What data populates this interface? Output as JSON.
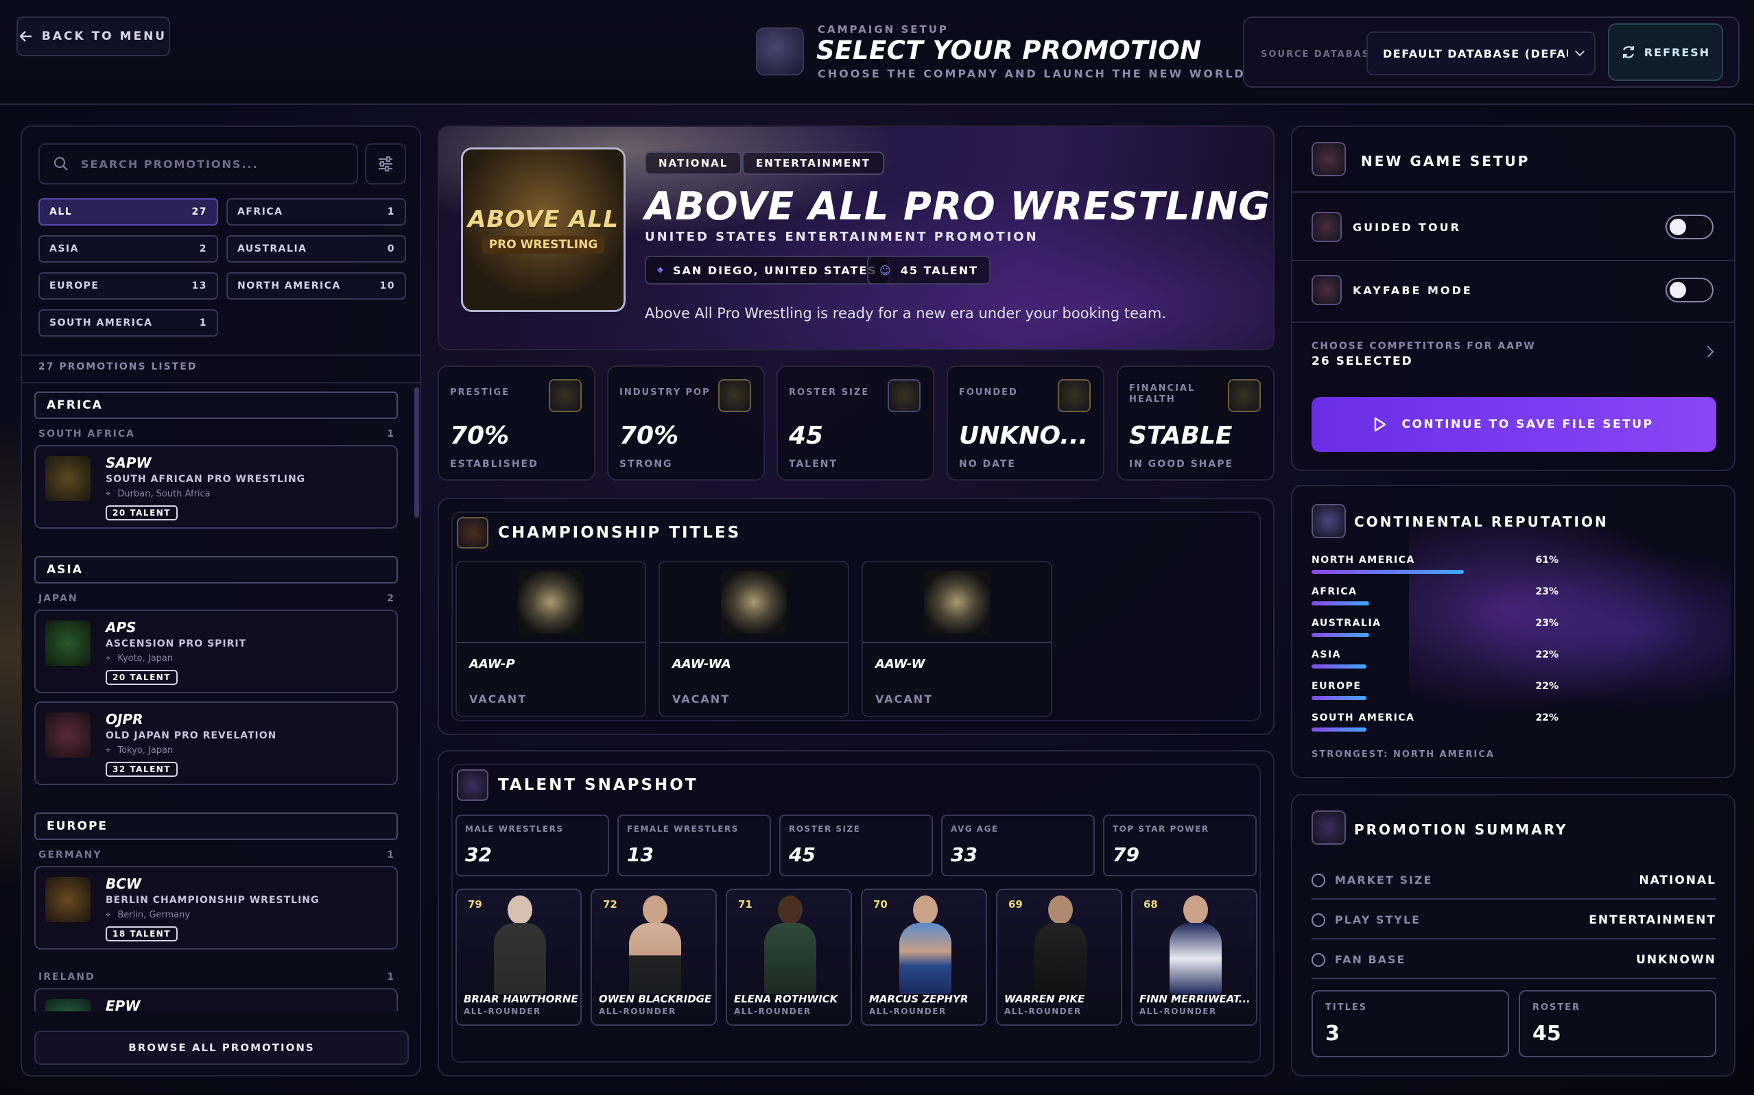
{
  "header": {
    "back_label": "BACK TO MENU",
    "kicker": "CAMPAIGN SETUP",
    "title": "SELECT YOUR PROMOTION",
    "subtitle": "CHOOSE THE COMPANY AND LAUNCH THE NEW WORLD STATE.",
    "source_label": "SOURCE DATABASE",
    "source_value": "DEFAULT DATABASE (DEFAULT)",
    "refresh_label": "REFRESH"
  },
  "sidebar": {
    "search_placeholder": "SEARCH PROMOTIONS...",
    "filters": [
      {
        "label": "ALL",
        "count": "27",
        "active": true
      },
      {
        "label": "AFRICA",
        "count": "1"
      },
      {
        "label": "ASIA",
        "count": "2"
      },
      {
        "label": "AUSTRALIA",
        "count": "0"
      },
      {
        "label": "EUROPE",
        "count": "13"
      },
      {
        "label": "NORTH AMERICA",
        "count": "10"
      },
      {
        "label": "SOUTH AMERICA",
        "count": "1"
      }
    ],
    "listed_count": "27 PROMOTIONS LISTED",
    "regions": [
      {
        "name": "AFRICA",
        "country": "SOUTH AFRICA",
        "country_count": "1"
      },
      {
        "name": "ASIA",
        "country": "JAPAN",
        "country_count": "2"
      },
      {
        "name": "EUROPE",
        "country": "GERMANY",
        "country_count": "1",
        "country2": "IRELAND",
        "country2_count": "1"
      }
    ],
    "promotions": [
      {
        "abbr": "SAPW",
        "name": "SOUTH AFRICAN PRO WRESTLING",
        "location": "Durban, South Africa",
        "talent": "20 TALENT"
      },
      {
        "abbr": "APS",
        "name": "ASCENSION PRO SPIRIT",
        "location": "Kyoto, Japan",
        "talent": "20 TALENT"
      },
      {
        "abbr": "OJPR",
        "name": "OLD JAPAN PRO REVELATION",
        "location": "Tokyo, Japan",
        "talent": "32 TALENT"
      },
      {
        "abbr": "BCW",
        "name": "BERLIN CHAMPIONSHIP WRESTLING",
        "location": "Berlin, Germany",
        "talent": "18 TALENT"
      },
      {
        "abbr": "EPW",
        "name": "",
        "location": "",
        "talent": ""
      }
    ],
    "browse_label": "BROWSE ALL PROMOTIONS"
  },
  "hero": {
    "logo_line1": "ABOVE ALL",
    "logo_line2": "PRO WRESTLING",
    "tags": [
      "NATIONAL",
      "ENTERTAINMENT"
    ],
    "title": "ABOVE ALL PRO WRESTLING",
    "subtitle": "UNITED STATES ENTERTAINMENT PROMOTION",
    "location": "SAN DIEGO, UNITED STATES",
    "talent": "45 TALENT",
    "description": "Above All Pro Wrestling is ready for a new era under your booking team."
  },
  "stats": [
    {
      "label": "PRESTIGE",
      "value": "70%",
      "sub": "ESTABLISHED"
    },
    {
      "label": "INDUSTRY POP",
      "value": "70%",
      "sub": "STRONG"
    },
    {
      "label": "ROSTER SIZE",
      "value": "45",
      "sub": "TALENT"
    },
    {
      "label": "FOUNDED",
      "value": "UNKNO...",
      "sub": "NO DATE"
    },
    {
      "label": "FINANCIAL HEALTH",
      "value": "STABLE",
      "sub": "IN GOOD SHAPE"
    }
  ],
  "championships": {
    "title": "CHAMPIONSHIP TITLES",
    "belts": [
      {
        "code": "AAW-P",
        "status": "VACANT"
      },
      {
        "code": "AAW-WA",
        "status": "VACANT"
      },
      {
        "code": "AAW-W",
        "status": "VACANT"
      }
    ]
  },
  "talent": {
    "title": "TALENT SNAPSHOT",
    "summary": [
      {
        "label": "MALE WRESTLERS",
        "value": "32"
      },
      {
        "label": "FEMALE WRESTLERS",
        "value": "13"
      },
      {
        "label": "ROSTER SIZE",
        "value": "45"
      },
      {
        "label": "AVG AGE",
        "value": "33"
      },
      {
        "label": "TOP STAR POWER",
        "value": "79"
      }
    ],
    "wrestlers": [
      {
        "rating": "79",
        "name": "BRIAR HAWTHORNE",
        "role": "ALL-ROUNDER"
      },
      {
        "rating": "72",
        "name": "OWEN BLACKRIDGE",
        "role": "ALL-ROUNDER"
      },
      {
        "rating": "71",
        "name": "ELENA ROTHWICK",
        "role": "ALL-ROUNDER"
      },
      {
        "rating": "70",
        "name": "MARCUS ZEPHYR",
        "role": "ALL-ROUNDER"
      },
      {
        "rating": "69",
        "name": "WARREN PIKE",
        "role": "ALL-ROUNDER"
      },
      {
        "rating": "68",
        "name": "FINN MERRIWEAT...",
        "role": "ALL-ROUNDER"
      }
    ]
  },
  "setup": {
    "title": "NEW GAME SETUP",
    "guided_tour": "GUIDED TOUR",
    "kayfabe": "KAYFABE MODE",
    "competitors_label": "CHOOSE COMPETITORS FOR AAPW",
    "competitors_value": "26 SELECTED",
    "continue_label": "CONTINUE TO SAVE FILE SETUP"
  },
  "reputation": {
    "title": "CONTINENTAL REPUTATION",
    "rows": [
      {
        "name": "NORTH AMERICA",
        "pct": "61%",
        "value": 0.61
      },
      {
        "name": "AFRICA",
        "pct": "23%",
        "value": 0.23
      },
      {
        "name": "AUSTRALIA",
        "pct": "23%",
        "value": 0.23
      },
      {
        "name": "ASIA",
        "pct": "22%",
        "value": 0.22
      },
      {
        "name": "EUROPE",
        "pct": "22%",
        "value": 0.22
      },
      {
        "name": "SOUTH AMERICA",
        "pct": "22%",
        "value": 0.22
      }
    ],
    "strongest": "STRONGEST: NORTH AMERICA"
  },
  "summary": {
    "title": "PROMOTION SUMMARY",
    "rows": [
      {
        "key": "MARKET SIZE",
        "value": "NATIONAL"
      },
      {
        "key": "PLAY STYLE",
        "value": "ENTERTAINMENT"
      },
      {
        "key": "FAN BASE",
        "value": "UNKNOWN"
      }
    ],
    "titles_label": "TITLES",
    "titles_value": "3",
    "roster_label": "ROSTER",
    "roster_value": "45"
  }
}
